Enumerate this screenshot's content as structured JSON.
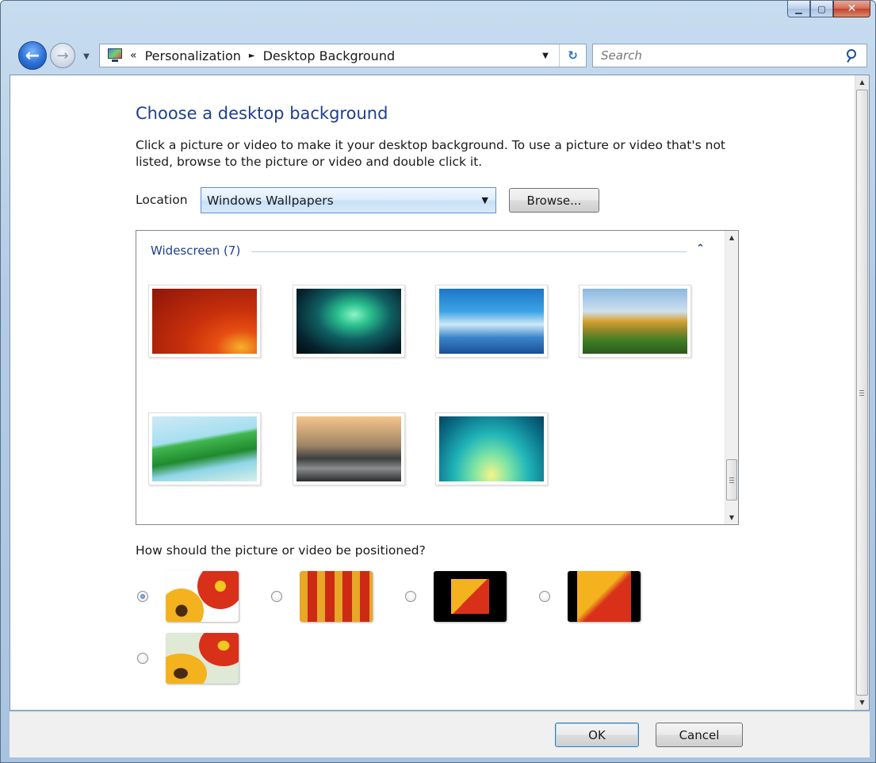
{
  "window": {
    "caption": {
      "minimize": "▁",
      "maximize": "▢",
      "close": "✕"
    }
  },
  "nav": {
    "back_glyph": "←",
    "forward_glyph": "→",
    "dropdown_glyph": "▼",
    "breadcrumb_prefix": "«",
    "breadcrumb": [
      "Personalization",
      "Desktop Background"
    ],
    "breadcrumb_sep": "►",
    "address_dropdown_glyph": "▼",
    "refresh_glyph": "↻",
    "search_placeholder": "Search"
  },
  "main": {
    "title": "Choose a desktop background",
    "description": "Click a picture or video to make it your desktop background. To use a picture or video that's not listed, browse to the picture or video and double click it.",
    "location_label": "Location",
    "location_value": "Windows Wallpapers",
    "browse_label": "Browse...",
    "group_label": "Widescreen (7)",
    "group_collapse_glyph": "⌃",
    "thumbnails": [
      "red-flower",
      "aurora",
      "fish",
      "landscape",
      "palm-leaf",
      "rock-lake",
      "green-aurora"
    ],
    "positions_label": "How should the picture or video be positioned?",
    "positions": [
      "fill",
      "tile",
      "center",
      "fit",
      "stretch"
    ],
    "selected_position": "fill"
  },
  "footer": {
    "ok_label": "OK",
    "cancel_label": "Cancel"
  },
  "colors": {
    "title": "#1e3f8f",
    "link": "#1e3f8f"
  }
}
